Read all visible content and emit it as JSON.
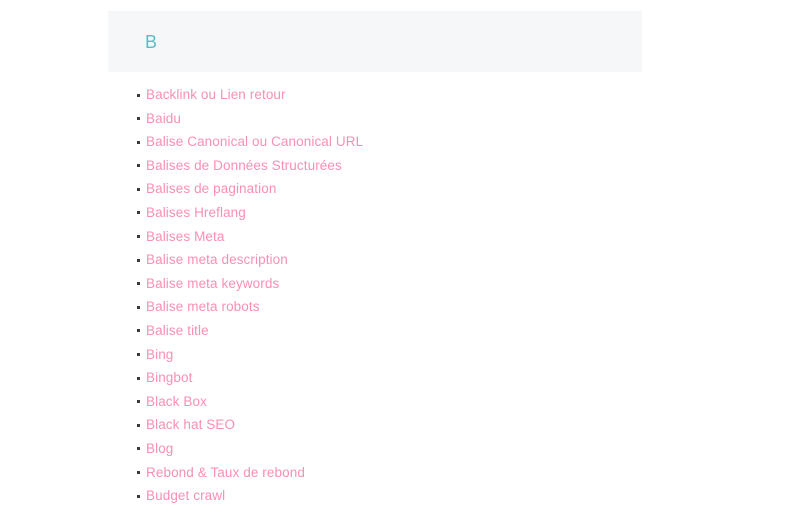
{
  "section": {
    "letter": "B",
    "letter_color": "#59bec3",
    "header_background": "#f6f7f9"
  },
  "glossary": {
    "link_color": "#fa8fb5",
    "bullet_color": "#3a3a3a",
    "terms": [
      {
        "label": "Backlink ou Lien retour"
      },
      {
        "label": "Baidu"
      },
      {
        "label": "Balise Canonical ou Canonical URL"
      },
      {
        "label": "Balises de Données Structurées"
      },
      {
        "label": "Balises de pagination"
      },
      {
        "label": "Balises Hreflang"
      },
      {
        "label": "Balises Meta"
      },
      {
        "label": "Balise meta description"
      },
      {
        "label": "Balise meta keywords"
      },
      {
        "label": "Balise meta robots"
      },
      {
        "label": "Balise title"
      },
      {
        "label": "Bing"
      },
      {
        "label": "Bingbot"
      },
      {
        "label": "Black Box"
      },
      {
        "label": "Black hat SEO"
      },
      {
        "label": "Blog"
      },
      {
        "label": "Rebond & Taux de rebond"
      },
      {
        "label": "Budget crawl"
      }
    ]
  }
}
